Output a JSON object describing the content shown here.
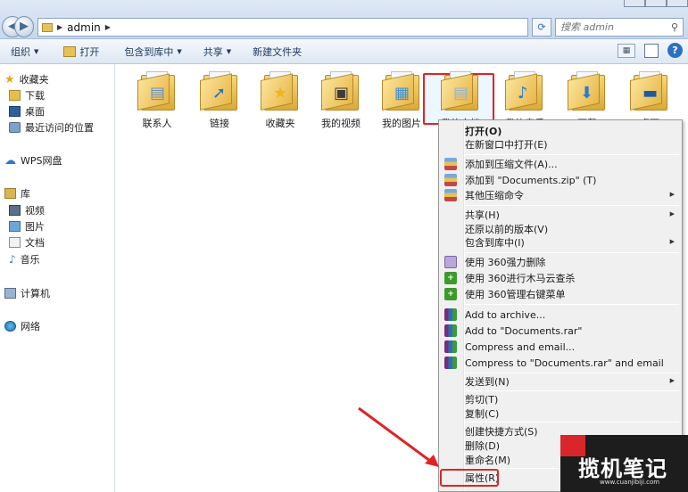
{
  "address": {
    "path": "admin"
  },
  "search": {
    "placeholder": "搜索 admin"
  },
  "toolbar": {
    "organize": "组织",
    "open": "打开",
    "include_library": "包含到库中",
    "share": "共享",
    "new_folder": "新建文件夹"
  },
  "sidebar": {
    "favorites": "收藏夹",
    "downloads": "下载",
    "desktop": "桌面",
    "recent": "最近访问的位置",
    "wps_cloud": "WPS网盘",
    "libraries": "库",
    "videos": "视频",
    "pictures": "图片",
    "documents": "文档",
    "music": "音乐",
    "computer": "计算机",
    "network": "网络"
  },
  "files": [
    {
      "label": "联系人",
      "icon": "contacts-folder-icon"
    },
    {
      "label": "链接",
      "icon": "links-folder-icon"
    },
    {
      "label": "收藏夹",
      "icon": "favorites-folder-icon"
    },
    {
      "label": "我的视频",
      "icon": "videos-folder-icon"
    },
    {
      "label": "我的图片",
      "icon": "pictures-folder-icon"
    },
    {
      "label": "我的文档",
      "icon": "documents-folder-icon",
      "selected": true
    },
    {
      "label": "我的音乐",
      "icon": "music-folder-icon"
    },
    {
      "label": "下载",
      "icon": "downloads-folder-icon"
    },
    {
      "label": "桌面",
      "icon": "desktop-folder-icon"
    }
  ],
  "context_menu": {
    "open": "打开(O)",
    "open_new_window": "在新窗口中打开(E)",
    "add_to_archive": "添加到压缩文件(A)...",
    "add_to_zip": "添加到 \"Documents.zip\" (T)",
    "other_compress": "其他压缩命令",
    "share": "共享(H)",
    "restore_versions": "还原以前的版本(V)",
    "include_library": "包含到库中(I)",
    "force_delete_360": "使用 360强力删除",
    "trojan_scan_360": "使用 360进行木马云查杀",
    "manage_menu_360": "使用 360管理右键菜单",
    "rar_add_archive": "Add to archive...",
    "rar_add_documents": "Add to \"Documents.rar\"",
    "rar_compress_email": "Compress and email...",
    "rar_compress_documents_email": "Compress to \"Documents.rar\" and email",
    "send_to": "发送到(N)",
    "cut": "剪切(T)",
    "copy": "复制(C)",
    "create_shortcut": "创建快捷方式(S)",
    "delete": "删除(D)",
    "rename": "重命名(M)",
    "properties": "属性(R)"
  },
  "watermark": {
    "text": "揽机笔记",
    "url": "www.cuanjibiji.com"
  },
  "colors": {
    "highlight_red": "#e02424",
    "menu_bg": "#f0f0f0",
    "toolbar_text": "#1e395b"
  }
}
